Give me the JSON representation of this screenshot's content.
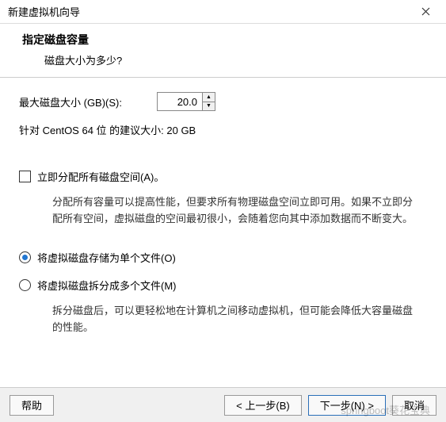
{
  "titlebar": {
    "title": "新建虚拟机向导"
  },
  "header": {
    "title": "指定磁盘容量",
    "subtitle": "磁盘大小为多少?"
  },
  "disk_size": {
    "label": "最大磁盘大小 (GB)(S):",
    "value": "20.0",
    "recommendation": "针对 CentOS 64 位 的建议大小: 20 GB"
  },
  "allocate_now": {
    "label": "立即分配所有磁盘空间(A)。",
    "checked": false,
    "description": "分配所有容量可以提高性能，但要求所有物理磁盘空间立即可用。如果不立即分配所有空间，虚拟磁盘的空间最初很小，会随着您向其中添加数据而不断变大。"
  },
  "store_option": {
    "single": {
      "label": "将虚拟磁盘存储为单个文件(O)",
      "checked": true
    },
    "split": {
      "label": "将虚拟磁盘拆分成多个文件(M)",
      "checked": false,
      "description": "拆分磁盘后，可以更轻松地在计算机之间移动虚拟机，但可能会降低大容量磁盘的性能。"
    }
  },
  "buttons": {
    "help": "帮助",
    "back": "< 上一步(B)",
    "next": "下一步(N) >",
    "cancel": "取消"
  },
  "watermark": "springboot葵花宝典"
}
